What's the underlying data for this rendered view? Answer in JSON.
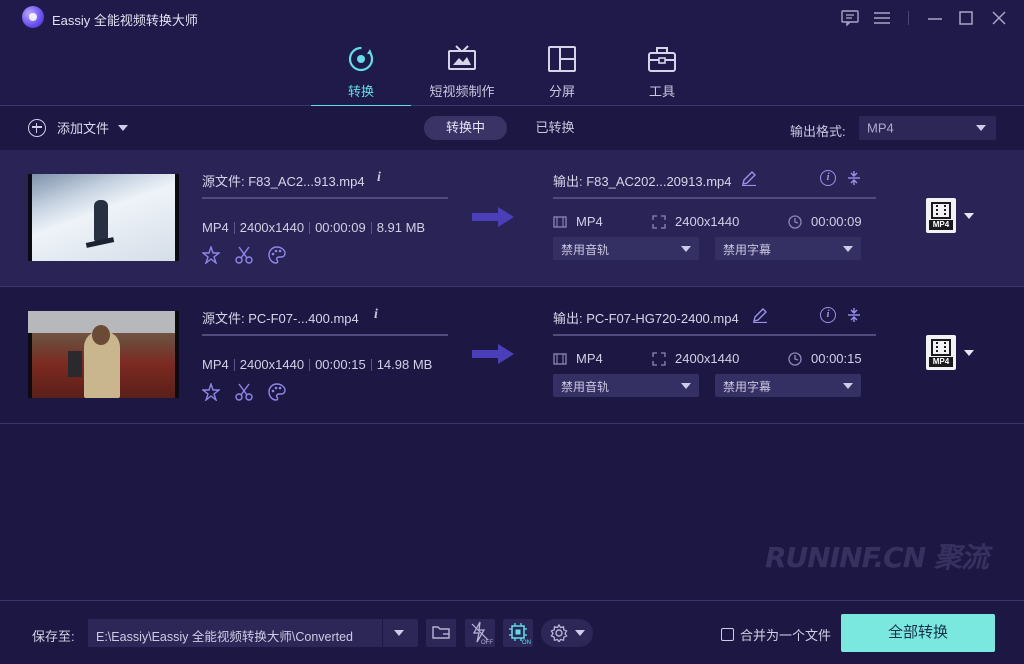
{
  "window": {
    "title": "Eassiy 全能视频转换大师"
  },
  "nav": {
    "tabs": [
      {
        "label": "转换",
        "icon": "convert-icon",
        "active": true
      },
      {
        "label": "短视频制作",
        "icon": "mv-icon",
        "active": false
      },
      {
        "label": "分屏",
        "icon": "collage-icon",
        "active": false
      },
      {
        "label": "工具",
        "icon": "toolbox-icon",
        "active": false
      }
    ]
  },
  "toolbar": {
    "add_file": "添加文件",
    "converting": "转换中",
    "converted": "已转换",
    "output_format_label": "输出格式:",
    "output_format_value": "MP4"
  },
  "files": [
    {
      "source_label": "源文件:  F83_AC2...913.mp4",
      "format": "MP4",
      "resolution": "2400x1440",
      "duration": "00:00:09",
      "size": "8.91 MB",
      "output_label": "输出:  F83_AC202...20913.mp4",
      "out_format": "MP4",
      "out_resolution": "2400x1440",
      "out_duration": "00:00:09",
      "audio": "禁用音轨",
      "subtitle": "禁用字幕",
      "badge": "MP4"
    },
    {
      "source_label": "源文件:  PC-F07-...400.mp4",
      "format": "MP4",
      "resolution": "2400x1440",
      "duration": "00:00:15",
      "size": "14.98 MB",
      "output_label": "输出:  PC-F07-HG720-2400.mp4",
      "out_format": "MP4",
      "out_resolution": "2400x1440",
      "out_duration": "00:00:15",
      "audio": "禁用音轨",
      "subtitle": "禁用字幕",
      "badge": "MP4"
    }
  ],
  "watermark": "RUNINF.CN 聚流",
  "footer": {
    "save_label": "保存至:",
    "save_path": "E:\\Eassiy\\Eassiy 全能视频转换大师\\Converted",
    "merge_label": "合并为一个文件",
    "convert_all": "全部转换",
    "hw_off": "OFF",
    "hw_on": "ON"
  },
  "colors": {
    "accent": "#5fe0e8",
    "convert_button": "#7be8e0",
    "background": "#1d1843"
  }
}
